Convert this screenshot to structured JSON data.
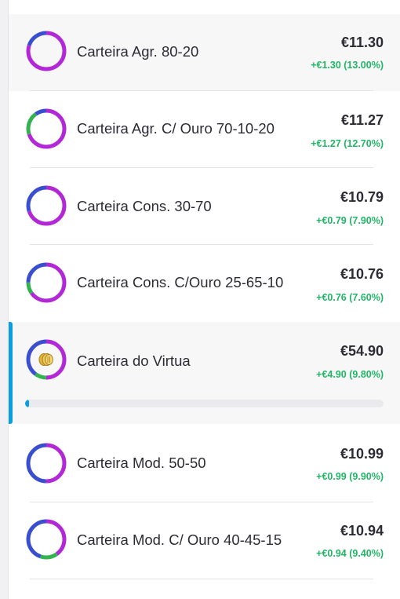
{
  "colors": {
    "purple": "#b228d6",
    "blue": "#3a4fd0",
    "green": "#33b24f",
    "positive": "#22b567",
    "accent": "#0aa0e0"
  },
  "portfolios": [
    {
      "name": "Carteira Agr. 80-20",
      "value": "€11.30",
      "change": "+€1.30 (13.00%)",
      "highlighted": true,
      "allocation": {
        "purple": 0.8,
        "blue": 0.2,
        "green": 0
      }
    },
    {
      "name": "Carteira Agr. C/ Ouro 70-10-20",
      "value": "€11.27",
      "change": "+€1.27 (12.70%)",
      "highlighted": false,
      "allocation": {
        "purple": 0.7,
        "blue": 0.1,
        "green": 0.2
      }
    },
    {
      "name": "Carteira Cons. 30-70",
      "value": "€10.79",
      "change": "+€0.79 (7.90%)",
      "highlighted": false,
      "allocation": {
        "purple": 0.7,
        "blue": 0.3,
        "green": 0
      }
    },
    {
      "name": "Carteira Cons. C/Ouro 25-65-10",
      "value": "€10.76",
      "change": "+€0.76 (7.60%)",
      "highlighted": false,
      "allocation": {
        "purple": 0.65,
        "blue": 0.25,
        "green": 0.1
      }
    },
    {
      "name": "Carteira do Virtua",
      "value": "€54.90",
      "change": "+€4.90 (9.80%)",
      "highlighted": true,
      "selected": true,
      "icon": "gold-coins-icon",
      "progress": 0.01,
      "allocation": {
        "purple": 0.5,
        "blue": 0.4,
        "green": 0.1
      }
    },
    {
      "name": "Carteira Mod. 50-50",
      "value": "€10.99",
      "change": "+€0.99 (9.90%)",
      "highlighted": false,
      "allocation": {
        "purple": 0.5,
        "blue": 0.5,
        "green": 0
      }
    },
    {
      "name": "Carteira Mod. C/ Ouro 40-45-15",
      "value": "€10.94",
      "change": "+€0.94 (9.40%)",
      "highlighted": false,
      "allocation": {
        "purple": 0.4,
        "blue": 0.45,
        "green": 0.15
      }
    }
  ]
}
